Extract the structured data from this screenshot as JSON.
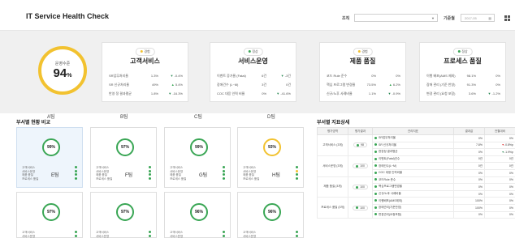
{
  "header": {
    "title": "IT Service Health Check",
    "filter1_label": "조직",
    "filter2_label": "기준월",
    "date_value": "2017-05"
  },
  "overall": {
    "label": "운영수준",
    "value": "94",
    "unit": "%"
  },
  "cards": [
    {
      "status": "경험",
      "status_color": "#f2c230",
      "name": "고객서비스",
      "rows": [
        {
          "metric": "SR업무처리율",
          "value": "1.3%",
          "dir": "down",
          "delta": "-0.4%"
        },
        {
          "metric": "SR 신규처리율",
          "value": "49%",
          "dir": "up",
          "delta": "5.4%"
        },
        {
          "metric": "반영 정 결과평균",
          "value": "1.8%",
          "dir": "down",
          "delta": "-16.3%"
        }
      ]
    },
    {
      "status": "정상",
      "status_color": "#3aa655",
      "name": "서비스운영",
      "rows": [
        {
          "metric": "이벤트 증가율 (Fatal)",
          "value": "6건",
          "dir": "down",
          "delta": "-3건"
        },
        {
          "metric": "장애건수 (L~M)",
          "value": "3건",
          "dir": "none",
          "delta": "0건"
        },
        {
          "metric": "COC 대응 인력 비율",
          "value": "0%",
          "dir": "down",
          "delta": "-41.6%"
        }
      ]
    },
    {
      "status": "경험",
      "status_color": "#f2c230",
      "name": "제품 품질",
      "rows": [
        {
          "metric": "코드 Rule 준수",
          "value": "0%",
          "dir": "none",
          "delta": "0%"
        },
        {
          "metric": "핵심 프로그램 변경율",
          "value": "73.5%",
          "dir": "up",
          "delta": "6.2%"
        },
        {
          "metric": "신규/노후 사례비율",
          "value": "1.1%",
          "dir": "down",
          "delta": "-0.9%"
        }
      ]
    },
    {
      "status": "정상",
      "status_color": "#3aa655",
      "name": "프로세스 품질",
      "rows": [
        {
          "metric": "이행 배포(AMS 제외)",
          "value": "98.1%",
          "dir": "none",
          "delta": "0%"
        },
        {
          "metric": "장애 관리 (기준 반영)",
          "value": "91.3%",
          "dir": "none",
          "delta": "0%"
        },
        {
          "metric": "변경 관리 (요청 포함)",
          "value": "3.6%",
          "dir": "down",
          "delta": "-1.2%"
        }
      ]
    }
  ],
  "dept": {
    "title": "부서별 현황 비교",
    "team_labels": [
      "A팀",
      "B팀",
      "C팀",
      "D팀"
    ],
    "teams": [
      {
        "score": "99%",
        "name": "E팀",
        "color": "green",
        "items": [
          "고객서비스",
          "서비스운영",
          "제품 품질",
          "프로세스 품질"
        ],
        "dots": [
          "g",
          "g",
          "g",
          "g"
        ]
      },
      {
        "score": "97%",
        "name": "F팀",
        "color": "green",
        "items": [
          "고객서비스",
          "서비스운영",
          "제품 품질",
          "프로세스 품질"
        ],
        "dots": [
          "g",
          "g",
          "g",
          "g"
        ]
      },
      {
        "score": "99%",
        "name": "G팀",
        "color": "green",
        "items": [
          "고객서비스",
          "서비스운영",
          "제품 품질",
          "프로세스 품질"
        ],
        "dots": [
          "g",
          "g",
          "g",
          "g"
        ]
      },
      {
        "score": "93%",
        "name": "H팀",
        "color": "yellow",
        "items": [
          "고객서비스",
          "서비스운영",
          "제품 품질",
          "프로세스 품질"
        ],
        "dots": [
          "g",
          "y",
          "g",
          "g"
        ]
      },
      {
        "score": "97%",
        "name": "",
        "color": "green",
        "items": [
          "고객서비스",
          "서비스운영"
        ],
        "dots": [
          "g",
          "g"
        ]
      },
      {
        "score": "97%",
        "name": "",
        "color": "green",
        "items": [
          "고객서비스",
          "서비스운영"
        ],
        "dots": [
          "g",
          "g"
        ]
      },
      {
        "score": "96%",
        "name": "",
        "color": "green",
        "items": [
          "고객서비스",
          "서비스운영"
        ],
        "dots": [
          "g",
          "g"
        ]
      },
      {
        "score": "96%",
        "name": "",
        "color": "green",
        "items": [
          "고객서비스",
          "서비스운영"
        ],
        "dots": [
          "g",
          "g"
        ]
      }
    ]
  },
  "detail": {
    "title": "부서별 지표상세",
    "headers": [
      "평가영역",
      "평가결과",
      "관리지표",
      "결과값",
      "전월대비"
    ],
    "groups": [
      {
        "area": "고객서비스 (3개)",
        "score": "98",
        "rows": [
          {
            "dot": "g",
            "kpi": "SR업무처리율",
            "value": "0%",
            "dir": "none",
            "delta": "0%"
          },
          {
            "dot": "g",
            "kpi": "SR 신규처리율",
            "value": "7.8%",
            "dir": "down-red",
            "delta": "-0.8%p"
          },
          {
            "dot": "g",
            "kpi": "현장정 결과평균",
            "value": "0%",
            "dir": "down",
            "delta": "-1.9%p"
          }
        ]
      },
      {
        "area": "서비스운영 (3개)",
        "score": "100",
        "rows": [
          {
            "dot": "g",
            "kpi": "이벤트(Fatal)건수",
            "value": "0건",
            "dir": "none",
            "delta": "0건"
          },
          {
            "dot": "g",
            "kpi": "장애건수(L~M)",
            "value": "0건",
            "dir": "none",
            "delta": "0건"
          },
          {
            "dot": "g",
            "kpi": "COC 대응 인력비율",
            "value": "0%",
            "dir": "none",
            "delta": "0%"
          }
        ]
      },
      {
        "area": "제품 품질 (3개)",
        "score": "100",
        "rows": [
          {
            "dot": "g",
            "kpi": "코드Rule 준수",
            "value": "0%",
            "dir": "none",
            "delta": "0%"
          },
          {
            "dot": "g",
            "kpi": "핵심프로그램변경율",
            "value": "0%",
            "dir": "none",
            "delta": "0%"
          },
          {
            "dot": "g",
            "kpi": "신규/노후 사례비율",
            "value": "0%",
            "dir": "none",
            "delta": "0%"
          }
        ]
      },
      {
        "area": "프로세스 품질 (3개)",
        "score": "100",
        "rows": [
          {
            "dot": "g",
            "kpi": "이행배포(AMS제외)",
            "value": "100%",
            "dir": "none",
            "delta": "0%"
          },
          {
            "dot": "g",
            "kpi": "장애관리(기준반영)",
            "value": "100%",
            "dir": "none",
            "delta": "0%"
          },
          {
            "dot": "g",
            "kpi": "변경관리(요청포함)",
            "value": "0%",
            "dir": "none",
            "delta": "0%"
          }
        ]
      }
    ]
  }
}
